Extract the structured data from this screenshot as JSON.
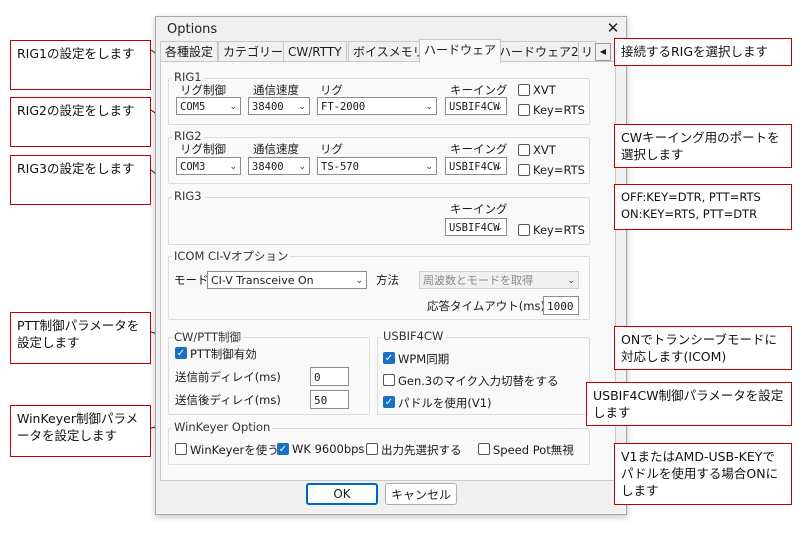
{
  "dialog": {
    "title": "Options",
    "close_glyph": "✕",
    "tabs": [
      "各種設定",
      "カテゴリー",
      "CW/RTTY",
      "ボイスメモリ",
      "ハードウェア",
      "ハードウェア2",
      "リ"
    ],
    "active_tab": "ハードウェア",
    "tab_scroll_glyph": "◀",
    "columns": {
      "rig_control": "リグ制御",
      "speed": "通信速度",
      "rig": "リグ",
      "keying": "キーイング"
    },
    "rig1": {
      "title": "RIG1",
      "port": "COM5",
      "speed": "38400",
      "rig": "FT-2000",
      "keying": "USBIF4CW",
      "xvt_label": "XVT",
      "keyrts_label": "Key=RTS"
    },
    "rig2": {
      "title": "RIG2",
      "port": "COM3",
      "speed": "38400",
      "rig": "TS-570",
      "keying": "USBIF4CW",
      "xvt_label": "XVT",
      "keyrts_label": "Key=RTS"
    },
    "rig3": {
      "title": "RIG3",
      "keying": "USBIF4CW",
      "keyrts_label": "Key=RTS"
    },
    "civ": {
      "title": "ICOM CI-Vオプション",
      "mode_label": "モード",
      "mode_value": "CI-V Transceive On",
      "method_label": "方法",
      "method_value": "周波数とモードを取得",
      "timeout_label": "応答タイムアウト(ms)",
      "timeout_value": "1000"
    },
    "cwptt": {
      "title": "CW/PTT制御",
      "ptt_enable": "PTT制御有効",
      "pre_delay_label": "送信前ディレイ(ms)",
      "pre_delay_value": "0",
      "post_delay_label": "送信後ディレイ(ms)",
      "post_delay_value": "50"
    },
    "usbif": {
      "title": "USBIF4CW",
      "wpm_sync": "WPM同期",
      "gen3_mic": "Gen.3のマイク入力切替をする",
      "use_paddle": "パドルを使用(V1)"
    },
    "winkeyer": {
      "title": "WinKeyer Option",
      "use": "WinKeyerを使う",
      "wk9600": "WK 9600bps",
      "output_select": "出力先選択する",
      "speed_pot": "Speed Pot無視"
    },
    "ok_label": "OK",
    "cancel_label": "キャンセル",
    "arrow_glyph": "⌄",
    "check_glyph": "✓"
  },
  "notes": {
    "rig1": "RIG1の設定をします",
    "rig2": "RIG2の設定をします",
    "rig3": "RIG3の設定をします",
    "ptt": "PTT制御パラメータを設定します",
    "winkeyer": "WinKeyer制御パラメータを設定します",
    "select_rig": "接続するRIGを選択します",
    "cw_port": "CWキーイング用のポートを選択します",
    "keyrts_line1": "OFF:KEY=DTR, PTT=RTS",
    "keyrts_line2": "ON:KEY=RTS, PTT=DTR",
    "transceive": "ONでトランシーブモードに対応します(ICOM)",
    "usbif": "USBIF4CW制御パラメータを設定します",
    "paddle": "V1またはAMD-USB-KEYでパドルを使用する場合ONにします"
  }
}
